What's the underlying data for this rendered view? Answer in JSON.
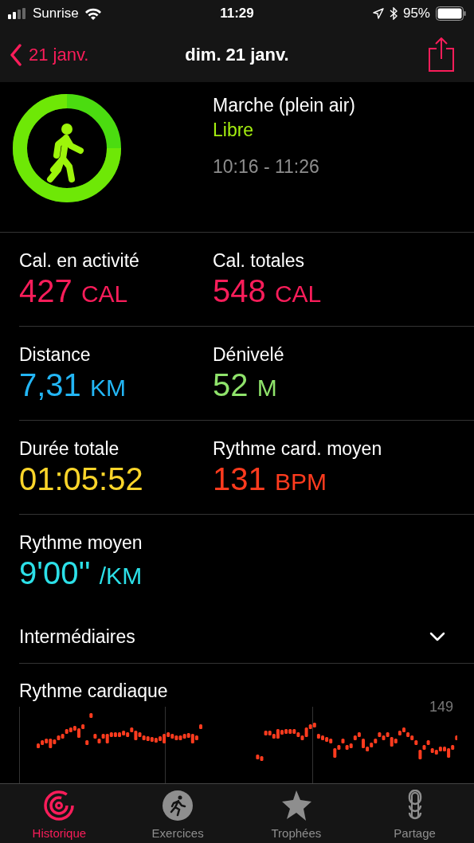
{
  "status_bar": {
    "carrier": "Sunrise",
    "time": "11:29",
    "battery": "95%"
  },
  "nav": {
    "back": "21 janv.",
    "title": "dim. 21 janv."
  },
  "workout": {
    "name": "Marche (plein air)",
    "type": "Libre",
    "time_range": "10:16 - 11:26"
  },
  "metric_rows": [
    [
      {
        "label": "Cal. en activité",
        "value": "427",
        "unit": "CAL",
        "color": "#fa1d5a"
      },
      {
        "label": "Cal. totales",
        "value": "548",
        "unit": "CAL",
        "color": "#fa1d5a"
      }
    ],
    [
      {
        "label": "Distance",
        "value": "7,31",
        "unit": "KM",
        "color": "#23b6f5"
      },
      {
        "label": "Dénivelé",
        "value": "52",
        "unit": "M",
        "color": "#8fe36b"
      }
    ],
    [
      {
        "label": "Durée totale",
        "value": "01:05:52",
        "color": "#fbd52a"
      },
      {
        "label": "Rythme card. moyen",
        "value": "131",
        "unit": "BPM",
        "color": "#ff3b1e"
      }
    ],
    [
      {
        "label": "Rythme moyen",
        "value": "9'00''",
        "unit": "/KM",
        "color": "#2ce0e8"
      }
    ]
  ],
  "splits": {
    "label": "Intermédiaires",
    "expanded": false
  },
  "heart_rate": {
    "title": "Rythme cardiaque",
    "max_label": "149"
  },
  "tab_bar": [
    {
      "label": "Historique",
      "selected": true
    },
    {
      "label": "Exercices",
      "selected": false
    },
    {
      "label": "Trophées",
      "selected": false
    },
    {
      "label": "Partage",
      "selected": false
    }
  ]
}
